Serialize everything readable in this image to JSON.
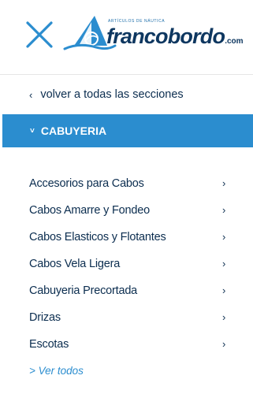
{
  "header": {
    "close_icon": "close-x-icon",
    "logo": {
      "tagline": "ARTÍCULOS DE NÁUTICA",
      "name": "francobordo",
      "tld": ".com"
    }
  },
  "nav": {
    "back_chevron": "‹",
    "back_label": "volver a todas las secciones"
  },
  "section": {
    "chevron": "˅",
    "title": "CABUYERIA"
  },
  "items": [
    {
      "label": "Accesorios para Cabos",
      "arrow": "›"
    },
    {
      "label": "Cabos Amarre y Fondeo",
      "arrow": "›"
    },
    {
      "label": "Cabos Elasticos y Flotantes",
      "arrow": "›"
    },
    {
      "label": "Cabos Vela Ligera",
      "arrow": "›"
    },
    {
      "label": "Cabuyeria Precortada",
      "arrow": "›"
    },
    {
      "label": "Drizas",
      "arrow": "›"
    },
    {
      "label": "Escotas",
      "arrow": "›"
    }
  ],
  "view_all": "> Ver todos",
  "colors": {
    "accent": "#2b8dcf",
    "text_dark": "#0b2d4f",
    "logo_dark": "#0e3760"
  }
}
